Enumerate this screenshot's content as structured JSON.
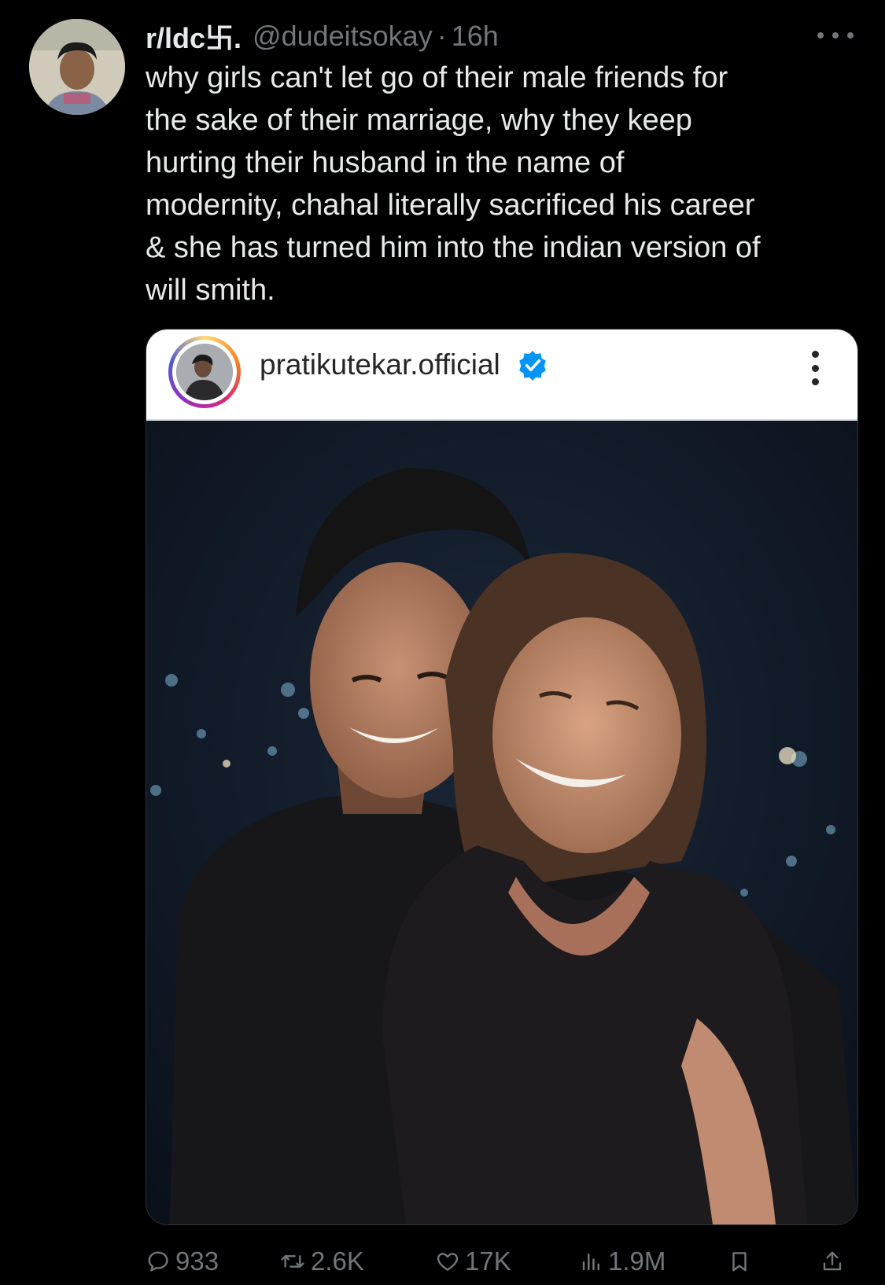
{
  "tweet": {
    "display_name": "r/ldc卐.",
    "handle": "@dudeitsokay",
    "separator": "·",
    "time": "16h",
    "text": "why girls can't let go of their male friends for\nthe sake of their marriage, why they keep\nhurting their husband in the name of\nmodernity, chahal literally sacrificed his career\n& she has turned him into the indian version of\nwill smith."
  },
  "embed": {
    "username": "pratikutekar.official",
    "verified": true
  },
  "actions": {
    "replies": "933",
    "reposts": "2.6K",
    "likes": "17K",
    "views": "1.9M"
  },
  "icons": [
    "more-icon",
    "verified-badge-icon",
    "reply-icon",
    "repost-icon",
    "like-icon",
    "views-icon",
    "bookmark-icon",
    "share-icon"
  ],
  "colors": {
    "background": "#000000",
    "text": "#e7e9ea",
    "muted": "#71767b",
    "verified": "#0095f6"
  }
}
